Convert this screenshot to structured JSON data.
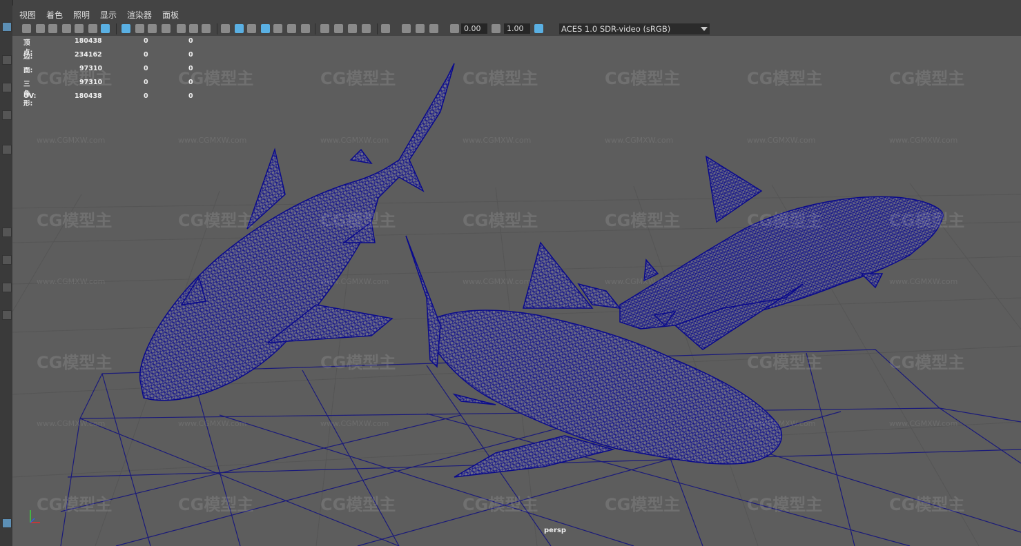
{
  "menu": {
    "items": [
      "视图",
      "着色",
      "照明",
      "显示",
      "渲染器",
      "面板"
    ]
  },
  "toolbar": {
    "exposure_value": "0.00",
    "gamma_value": "1.00",
    "color_space": "ACES 1.0 SDR-video (sRGB)"
  },
  "hud": {
    "rows": [
      {
        "label": "顶点:",
        "v1": "180438",
        "v2": "0",
        "v3": "0"
      },
      {
        "label": "边:",
        "v1": "234162",
        "v2": "0",
        "v3": "0"
      },
      {
        "label": "面:",
        "v1": "97310",
        "v2": "0",
        "v3": "0"
      },
      {
        "label": "三角形:",
        "v1": "97310",
        "v2": "0",
        "v3": "0"
      },
      {
        "label": "UV:",
        "v1": "180438",
        "v2": "0",
        "v3": "0"
      }
    ]
  },
  "viewport": {
    "camera_label": "persp",
    "watermark_text": "CG模型主",
    "watermark_url": "www.CGMXW.com",
    "mesh_color": "#0a0a8c",
    "grid_color": "#1a1a7a",
    "background": "#5d5d5d"
  },
  "icons": [
    "camera-icon",
    "lock-icon",
    "grid-icon",
    "wireframe-icon",
    "shaded-icon",
    "light-icon",
    "exposure-icon",
    "gamma-icon",
    "color-space-icon"
  ]
}
